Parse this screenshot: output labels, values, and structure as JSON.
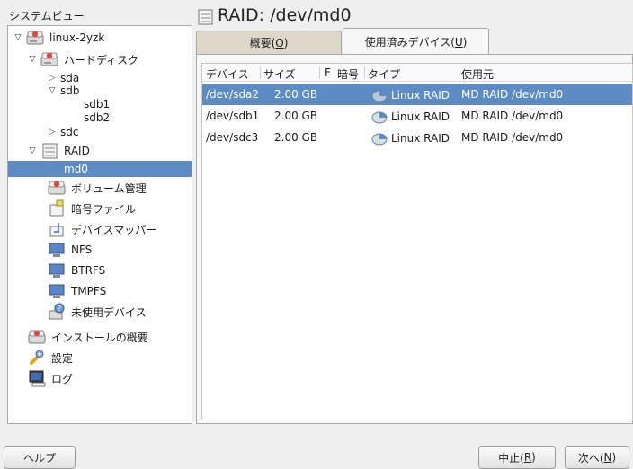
{
  "system_view": {
    "title": "システムビュー",
    "tree": {
      "host": "linux-2yzk",
      "harddisks": "ハードディスク",
      "sda": "sda",
      "sdb": "sdb",
      "sdb1": "sdb1",
      "sdb2": "sdb2",
      "sdc": "sdc",
      "raid": "RAID",
      "md0": "md0",
      "volume_mgmt": "ボリューム管理",
      "crypt_files": "暗号ファイル",
      "device_mapper": "デバイスマッパー",
      "nfs": "NFS",
      "btrfs": "BTRFS",
      "tmpfs": "TMPFS",
      "unused": "未使用デバイス",
      "install_summary": "インストールの概要",
      "settings": "設定",
      "log": "ログ"
    }
  },
  "main": {
    "title": "RAID: /dev/md0",
    "tabs": {
      "overview": {
        "label": "概要(",
        "mnemonic": "O",
        "tail": ")"
      },
      "used_devices": {
        "label": "使用済みデバイス(",
        "mnemonic": "U",
        "tail": ")"
      }
    },
    "table": {
      "headers": [
        "デバイス",
        "サイズ",
        "F",
        "暗号",
        "タイプ",
        "使用元"
      ],
      "rows": [
        {
          "device": "/dev/sda2",
          "size": "2.00 GB",
          "f": "",
          "crypt": "",
          "type": "Linux RAID",
          "used_by": "MD RAID /dev/md0"
        },
        {
          "device": "/dev/sdb1",
          "size": "2.00 GB",
          "f": "",
          "crypt": "",
          "type": "Linux RAID",
          "used_by": "MD RAID /dev/md0"
        },
        {
          "device": "/dev/sdc3",
          "size": "2.00 GB",
          "f": "",
          "crypt": "",
          "type": "Linux RAID",
          "used_by": "MD RAID /dev/md0"
        }
      ]
    }
  },
  "buttons": {
    "help": "ヘルプ",
    "abort": {
      "label": "中止(",
      "mnemonic": "R",
      "tail": ")"
    },
    "next": {
      "label": "次へ(",
      "mnemonic": "N",
      "tail": ")"
    }
  }
}
